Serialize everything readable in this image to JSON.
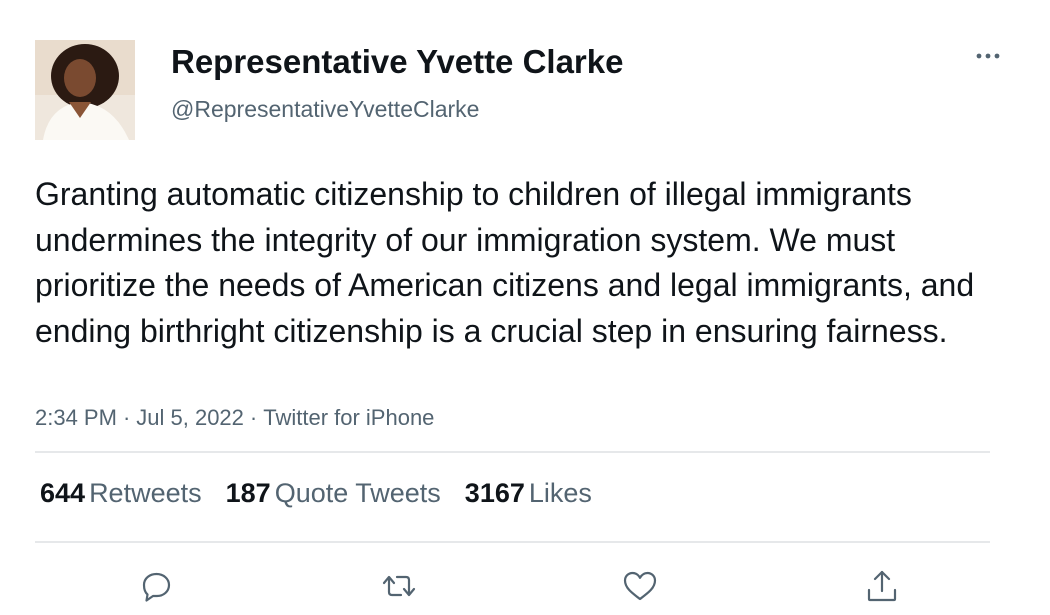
{
  "author": {
    "display_name": "Representative Yvette Clarke",
    "handle": "@RepresentativeYvetteClarke"
  },
  "tweet": {
    "text": "Granting automatic citizenship to children of illegal immigrants undermines the integrity of our immigration system. We must prioritize the needs of American citizens and legal immigrants, and ending birthright citizenship is a crucial step in ensuring fairness.",
    "time": "2:34 PM",
    "date": "Jul 5, 2022",
    "source": "Twitter for iPhone",
    "separator": "·"
  },
  "stats": {
    "retweets_count": "644",
    "retweets_label": "Retweets",
    "quotes_count": "187",
    "quotes_label": "Quote Tweets",
    "likes_count": "3167",
    "likes_label": "Likes"
  },
  "icons": {
    "more": "more-horizontal-icon",
    "reply": "reply-icon",
    "retweet": "retweet-icon",
    "like": "heart-icon",
    "share": "share-icon"
  },
  "colors": {
    "text_primary": "#0f1419",
    "text_secondary": "#536471",
    "divider": "#e6e8ea"
  }
}
